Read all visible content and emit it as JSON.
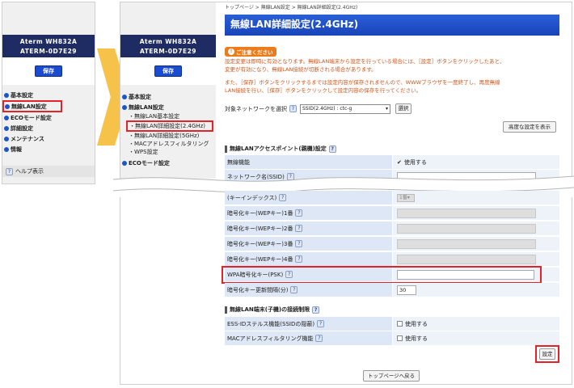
{
  "left_panel": {
    "device_model": "Aterm WH832A",
    "device_id": "ATERM-0D7E29",
    "save_label": "保存",
    "nav": [
      {
        "label": "基本設定"
      },
      {
        "label": "無線LAN設定"
      },
      {
        "label": "ECOモード設定"
      },
      {
        "label": "詳細設定"
      },
      {
        "label": "メンテナンス"
      },
      {
        "label": "情報"
      }
    ],
    "help_label": "ヘルプ表示"
  },
  "mid_panel": {
    "device_model": "Aterm WH832A",
    "device_id": "ATERM-0D7E29",
    "save_label": "保存",
    "nav_basic": "基本設定",
    "nav_wlan": "無線LAN設定",
    "sub_items": [
      "無線LAN基本設定",
      "無線LAN詳細設定(2.4GHz)",
      "無線LAN詳細設定(5GHz)",
      "MACアドレスフィルタリング",
      "WPS設定"
    ],
    "nav_eco": "ECOモード設定"
  },
  "content": {
    "breadcrumb": "トップページ > 無線LAN設定 > 無線LAN詳細設定(2.4GHz)",
    "title": "無線LAN詳細設定(2.4GHz)",
    "caution_label": "ご注意ください",
    "caution_lines": [
      "設定変更は即時に有効となります。無線LAN端末から設定を行っている場合には、［設定］ボタンをクリックしたあと、",
      "変更が有効になり、無線LAN接続が切断される場合があります。",
      "",
      "また、［保存］ボタンをクリックするまでは設定内容が保存されませんので、WWWブラウザを一度終了し、再度無線",
      "LAN接続を行い、［保存］ボタンをクリックして設定内容の保存を行ってください。"
    ],
    "network_select_label": "対象ネットワークを選択",
    "network_select_value": "SSID(2.4GHz) : ctc-g",
    "select_button": "選択",
    "advanced_button": "高度な設定を表示",
    "section1_title": "無線LANアクセスポイント(親機)設定",
    "rows": [
      {
        "label": "無線機能",
        "value": "使用する"
      },
      {
        "label": "ネットワーク名(SSID)",
        "value": ""
      },
      {
        "label": "(キーインデックス)",
        "value": "1番"
      },
      {
        "label": "暗号化キー(WEPキー)1番",
        "value": ""
      },
      {
        "label": "暗号化キー(WEPキー)2番",
        "value": ""
      },
      {
        "label": "暗号化キー(WEPキー)3番",
        "value": ""
      },
      {
        "label": "暗号化キー(WEPキー)4番",
        "value": ""
      },
      {
        "label": "WPA暗号化キー(PSK)",
        "value": ""
      },
      {
        "label": "暗号化キー更新間隔(分)",
        "value": "30"
      }
    ],
    "section2_title": "無線LAN端末(子機)の接続制限",
    "rows2": [
      {
        "label": "ESS-IDステルス機能(SSIDの隠蔽)",
        "value": "使用する"
      },
      {
        "label": "MACアドレスフィルタリング機能",
        "value": "使用する"
      }
    ],
    "set_button": "設定",
    "top_button": "トップページへ戻る"
  },
  "colors": {
    "accent_red": "#e2242a",
    "title_blue": "#1845b8",
    "caution_orange": "#ee7b1a",
    "arrow_yellow": "#f7c24a"
  }
}
